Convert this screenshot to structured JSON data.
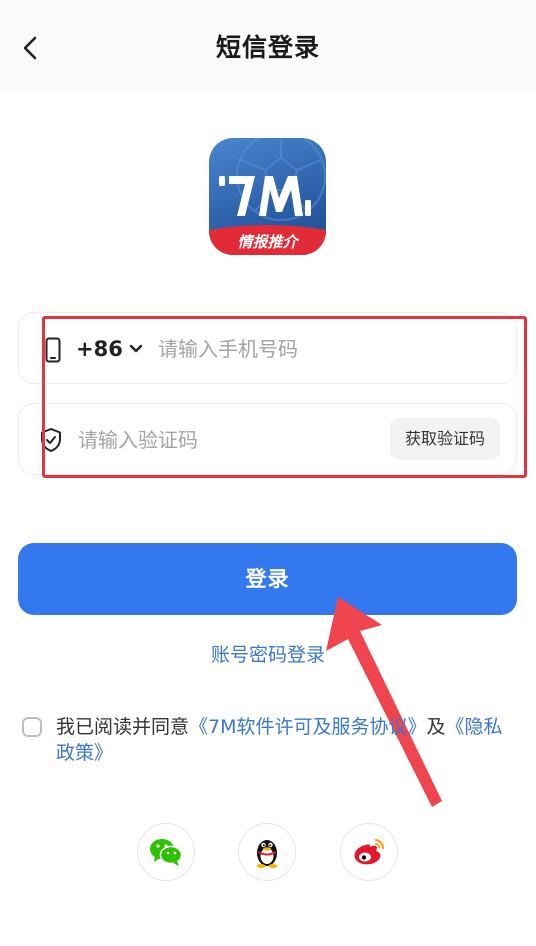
{
  "header": {
    "title": "短信登录",
    "back_icon": "chevron-left-icon"
  },
  "logo": {
    "brand_text": "7M",
    "banner_text": "情报推介",
    "bg_color": "#2f66b3",
    "banner_color": "#e22b36"
  },
  "phone_field": {
    "icon": "phone-icon",
    "country_code": "+86",
    "placeholder": "请输入手机号码",
    "value": ""
  },
  "code_field": {
    "icon": "shield-check-icon",
    "placeholder": "请输入验证码",
    "value": "",
    "get_code_label": "获取验证码"
  },
  "login_button": {
    "label": "登录",
    "color": "#3478f0"
  },
  "password_login_link": "账号密码登录",
  "agreement": {
    "checked": false,
    "prefix": "我已阅读并同意",
    "license_link": "《7M软件许可及服务协议》",
    "and": "及",
    "privacy_link": "《隐私政策》"
  },
  "social_logins": [
    {
      "name": "wechat",
      "icon": "wechat-icon",
      "color": "#2dc100"
    },
    {
      "name": "qq",
      "icon": "qq-penguin-icon",
      "color": "#111111"
    },
    {
      "name": "weibo",
      "icon": "weibo-icon",
      "color": "#e6162d"
    }
  ],
  "annotation": {
    "box_color": "#e8323c",
    "arrow_color": "#f0444e"
  }
}
